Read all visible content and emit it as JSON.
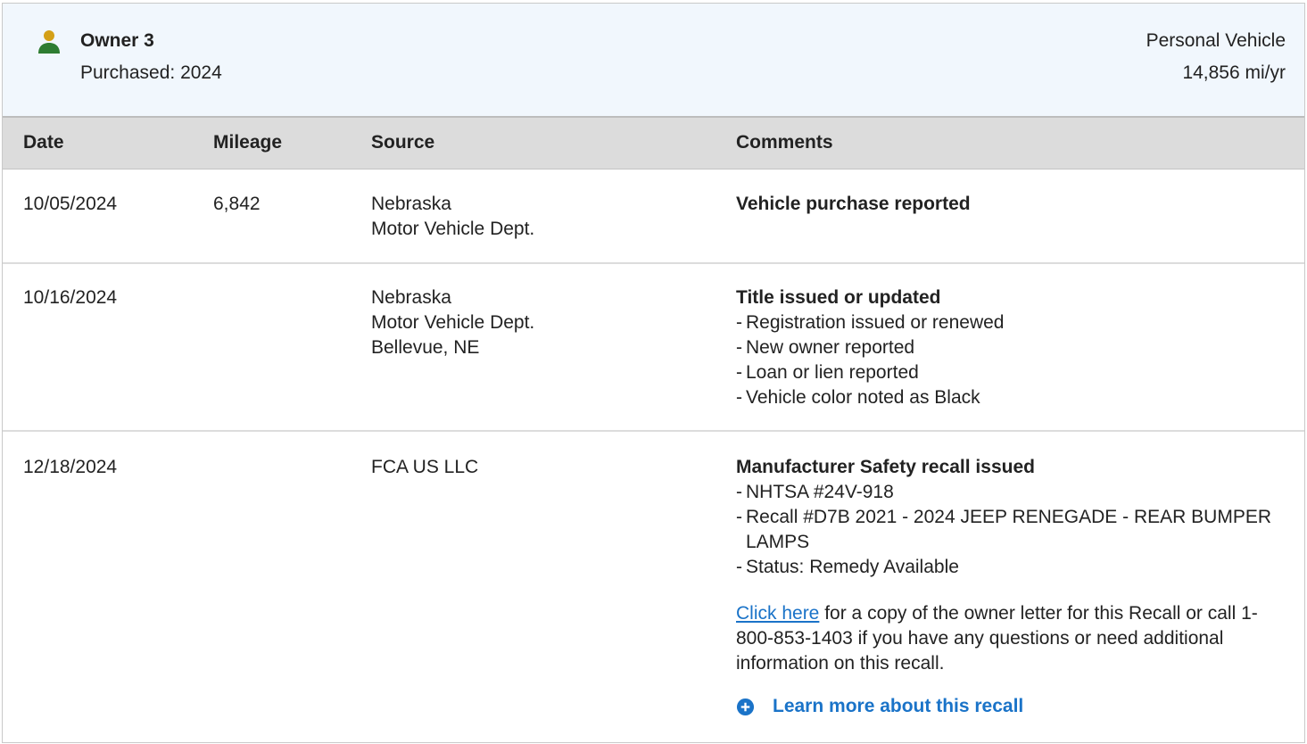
{
  "owner": {
    "title": "Owner 3",
    "purchased": "Purchased: 2024",
    "vehicle_type": "Personal Vehicle",
    "annual_mileage": "14,856 mi/yr",
    "icon": "person-icon"
  },
  "table": {
    "headers": {
      "date": "Date",
      "mileage": "Mileage",
      "source": "Source",
      "comments": "Comments"
    },
    "rows": [
      {
        "date": "10/05/2024",
        "mileage": "6,842",
        "source": [
          "Nebraska",
          "Motor Vehicle Dept."
        ],
        "comment_title": "Vehicle purchase reported",
        "comment_items": []
      },
      {
        "date": "10/16/2024",
        "mileage": "",
        "source": [
          "Nebraska",
          "Motor Vehicle Dept.",
          "Bellevue, NE"
        ],
        "comment_title": "Title issued or updated",
        "comment_items": [
          "Registration issued or renewed",
          "New owner reported",
          "Loan or lien reported",
          "Vehicle color noted as Black"
        ]
      },
      {
        "date": "12/18/2024",
        "mileage": "",
        "source": [
          "FCA US LLC"
        ],
        "comment_title": "Manufacturer Safety recall issued",
        "comment_items": [
          "NHTSA #24V-918",
          "Recall #D7B 2021 - 2024 JEEP RENEGADE - REAR BUMPER LAMPS",
          "Status: Remedy Available"
        ],
        "recall_note_link": "Click here",
        "recall_note_text": " for a copy of the owner letter for this Recall or call 1- 800-853-1403 if you have any questions or need additional information on this recall.",
        "learn_more": "Learn more about this recall"
      }
    ]
  },
  "colors": {
    "header_bg": "#f1f7fd",
    "table_head_bg": "#dcdcdc",
    "link": "#1a73c8",
    "person_head": "#d4a017",
    "person_body": "#2e7d32"
  }
}
